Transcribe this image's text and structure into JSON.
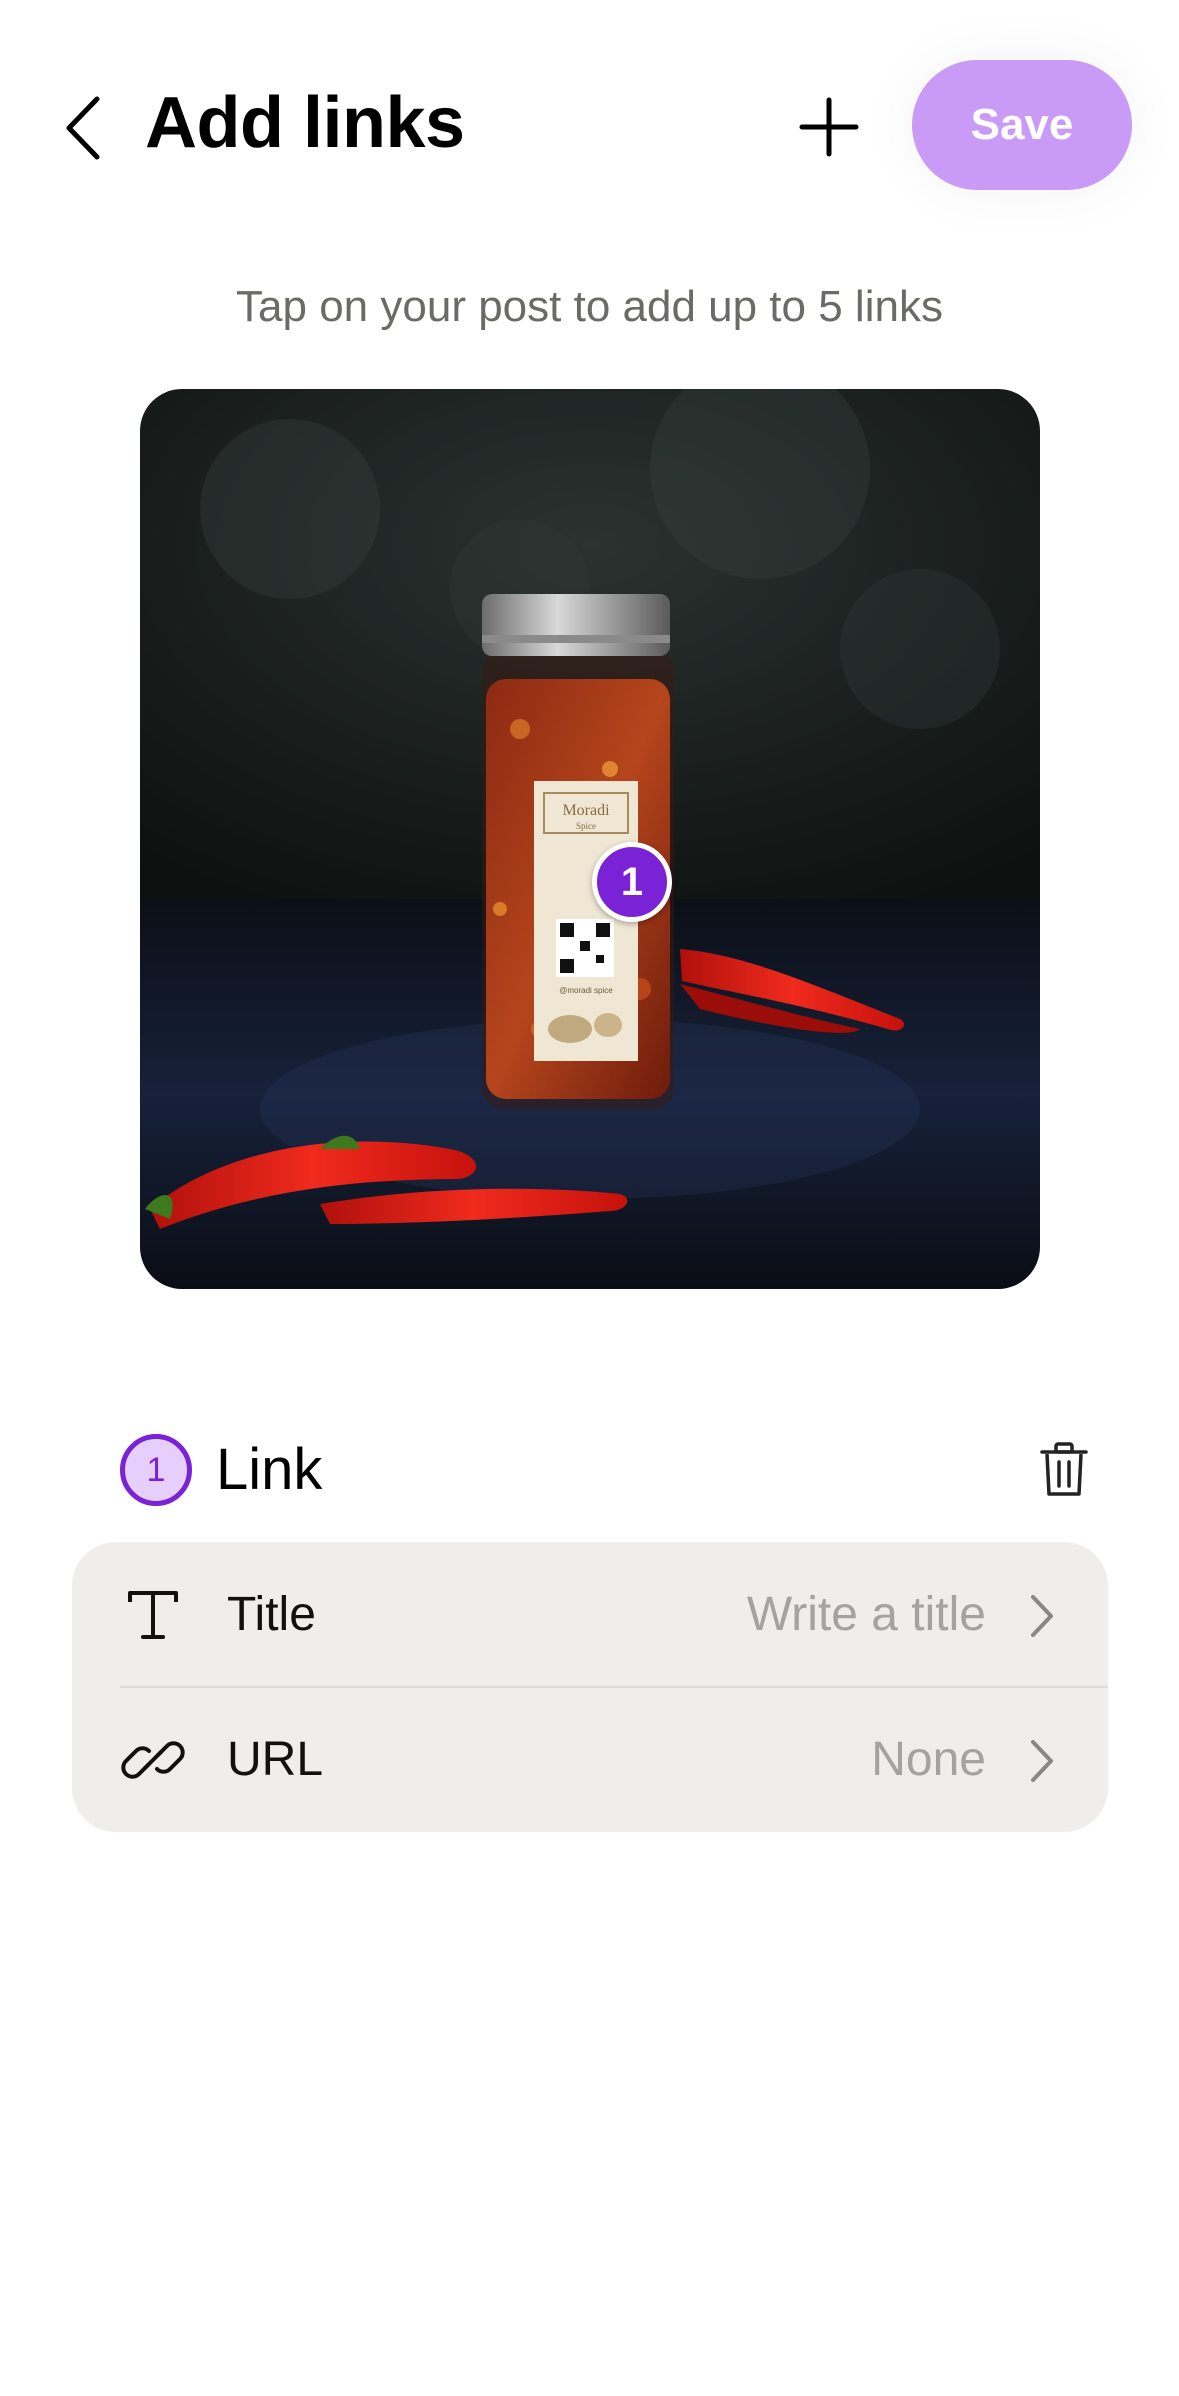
{
  "header": {
    "title": "Add links",
    "save_label": "Save",
    "back_icon": "chevron-left-icon",
    "add_icon": "plus-icon"
  },
  "hint": "Tap on your post to add up to 5 links",
  "photo": {
    "label_brand": "Moradi",
    "label_sub": "Spice",
    "label_handle": "@moradi spice"
  },
  "marker": {
    "number": "1"
  },
  "link": {
    "number": "1",
    "label": "Link",
    "delete_icon": "trash-icon",
    "rows": [
      {
        "icon": "text-icon",
        "label": "Title",
        "value": "Write a title"
      },
      {
        "icon": "link-icon",
        "label": "URL",
        "value": "None"
      }
    ]
  },
  "colors": {
    "accent": "#7a22d6",
    "save_button": "#c99af6",
    "badge_fill": "#e6cffc",
    "card_bg": "#efeeec"
  }
}
